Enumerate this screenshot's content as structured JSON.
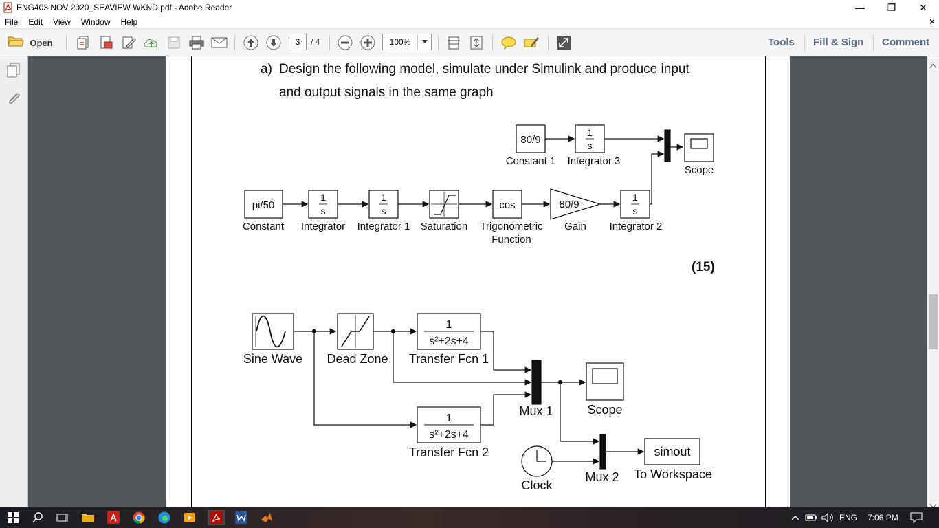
{
  "window": {
    "title": "ENG403 NOV 2020_SEAVIEW WKND.pdf - Adobe Reader",
    "minimize": "—",
    "maximize": "❐",
    "close": "✕"
  },
  "menu": {
    "items": [
      "File",
      "Edit",
      "View",
      "Window",
      "Help"
    ],
    "close": "×"
  },
  "toolbar": {
    "open_label": "Open",
    "page_current": "3",
    "page_total": "/ 4",
    "zoom": "100%",
    "tools": "Tools",
    "fill_sign": "Fill & Sign",
    "comment": "Comment"
  },
  "document": {
    "question_label": "a)",
    "question_line1": "Design the following model, simulate under Simulink and produce input",
    "question_line2": "and output signals in the same graph",
    "marks": "(15)",
    "diagram1": {
      "constant": "pi/50",
      "integrator_num": "1",
      "integrator_den": "s",
      "trig": "cos",
      "gain": "80/9",
      "constant1": "80/9",
      "labels": {
        "constant": "Constant",
        "integrator": "Integrator",
        "integrator1": "Integrator 1",
        "saturation": "Saturation",
        "trig1": "Trigonometric",
        "trig2": "Function",
        "gain": "Gain",
        "integrator2": "Integrator 2",
        "constant1": "Constant 1",
        "integrator3": "Integrator 3",
        "scope": "Scope"
      }
    },
    "diagram2": {
      "tf_num": "1",
      "tf_den": "s²+2s+4",
      "simout": "simout",
      "labels": {
        "sine": "Sine Wave",
        "deadzone": "Dead Zone",
        "tf1": "Transfer Fcn 1",
        "tf2": "Transfer Fcn 2",
        "mux1": "Mux 1",
        "scope": "Scope",
        "clock": "Clock",
        "mux2": "Mux 2",
        "workspace": "To Workspace"
      }
    }
  },
  "taskbar": {
    "language": "ENG",
    "time": "7:06 PM"
  }
}
